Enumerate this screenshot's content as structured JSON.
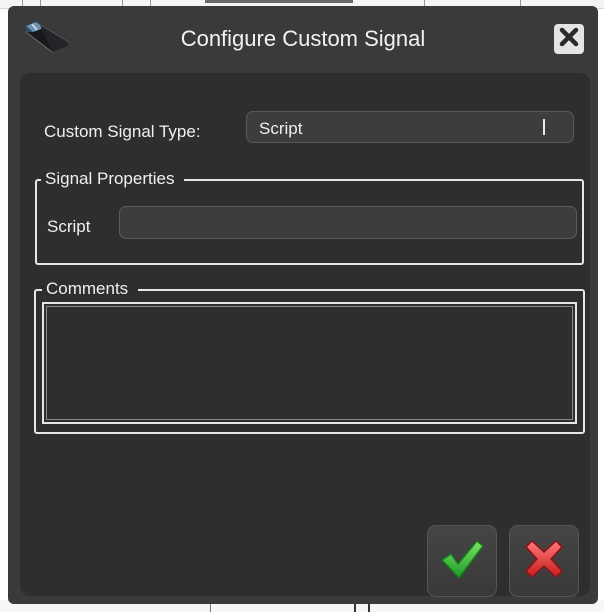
{
  "dialog": {
    "title": "Configure Custom Signal",
    "app_icon": "clapperboard-icon",
    "close_icon": "close-icon"
  },
  "form": {
    "custom_signal_type_label": "Custom Signal Type:",
    "custom_signal_type_value": "Script",
    "signal_properties_legend": "Signal Properties",
    "script_label": "Script",
    "script_value": "",
    "comments_legend": "Comments",
    "comments_value": ""
  },
  "actions": {
    "ok_icon": "checkmark-icon",
    "cancel_icon": "cross-icon"
  },
  "colors": {
    "dialog_bg": "#3a3a3a",
    "panel_bg": "#2e2e2e",
    "ok_green": "#2fb52f",
    "cancel_red": "#e02a2a"
  }
}
